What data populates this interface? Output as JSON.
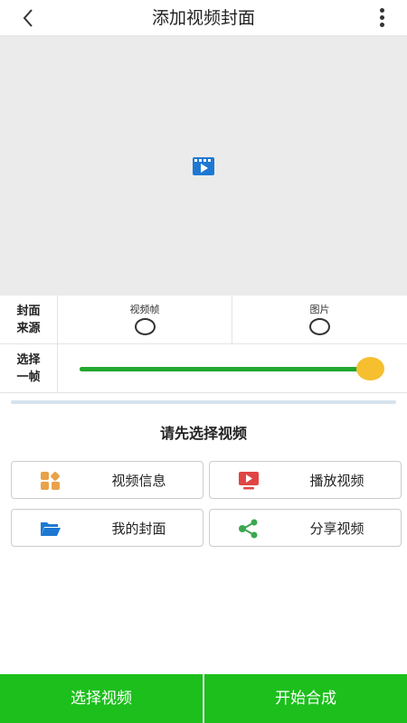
{
  "header": {
    "title": "添加视频封面"
  },
  "icons": {
    "back": "chevron-left-icon",
    "more": "more-vertical-icon",
    "preview": "video-play-icon",
    "info": "grid-shapes-icon",
    "play": "tv-play-icon",
    "cover": "folder-open-icon",
    "share": "share-icon"
  },
  "cover_source": {
    "label": "封面来源",
    "options": [
      "视频帧",
      "图片"
    ]
  },
  "frame_select": {
    "label": "选择一帧",
    "value_fraction": 1.0
  },
  "prompt": "请先选择视频",
  "actions": {
    "info": "视频信息",
    "play": "播放视频",
    "cover": "我的封面",
    "share": "分享视频"
  },
  "bottom": {
    "select_video": "选择视频",
    "start_compose": "开始合成"
  },
  "colors": {
    "accent_green": "#1cbf1c",
    "slider_green": "#22a830",
    "thumb_yellow": "#f6bf30",
    "icon_blue": "#1e78d2",
    "icon_orange": "#e8a24a",
    "icon_red": "#e04545",
    "icon_green": "#3aa84f"
  }
}
